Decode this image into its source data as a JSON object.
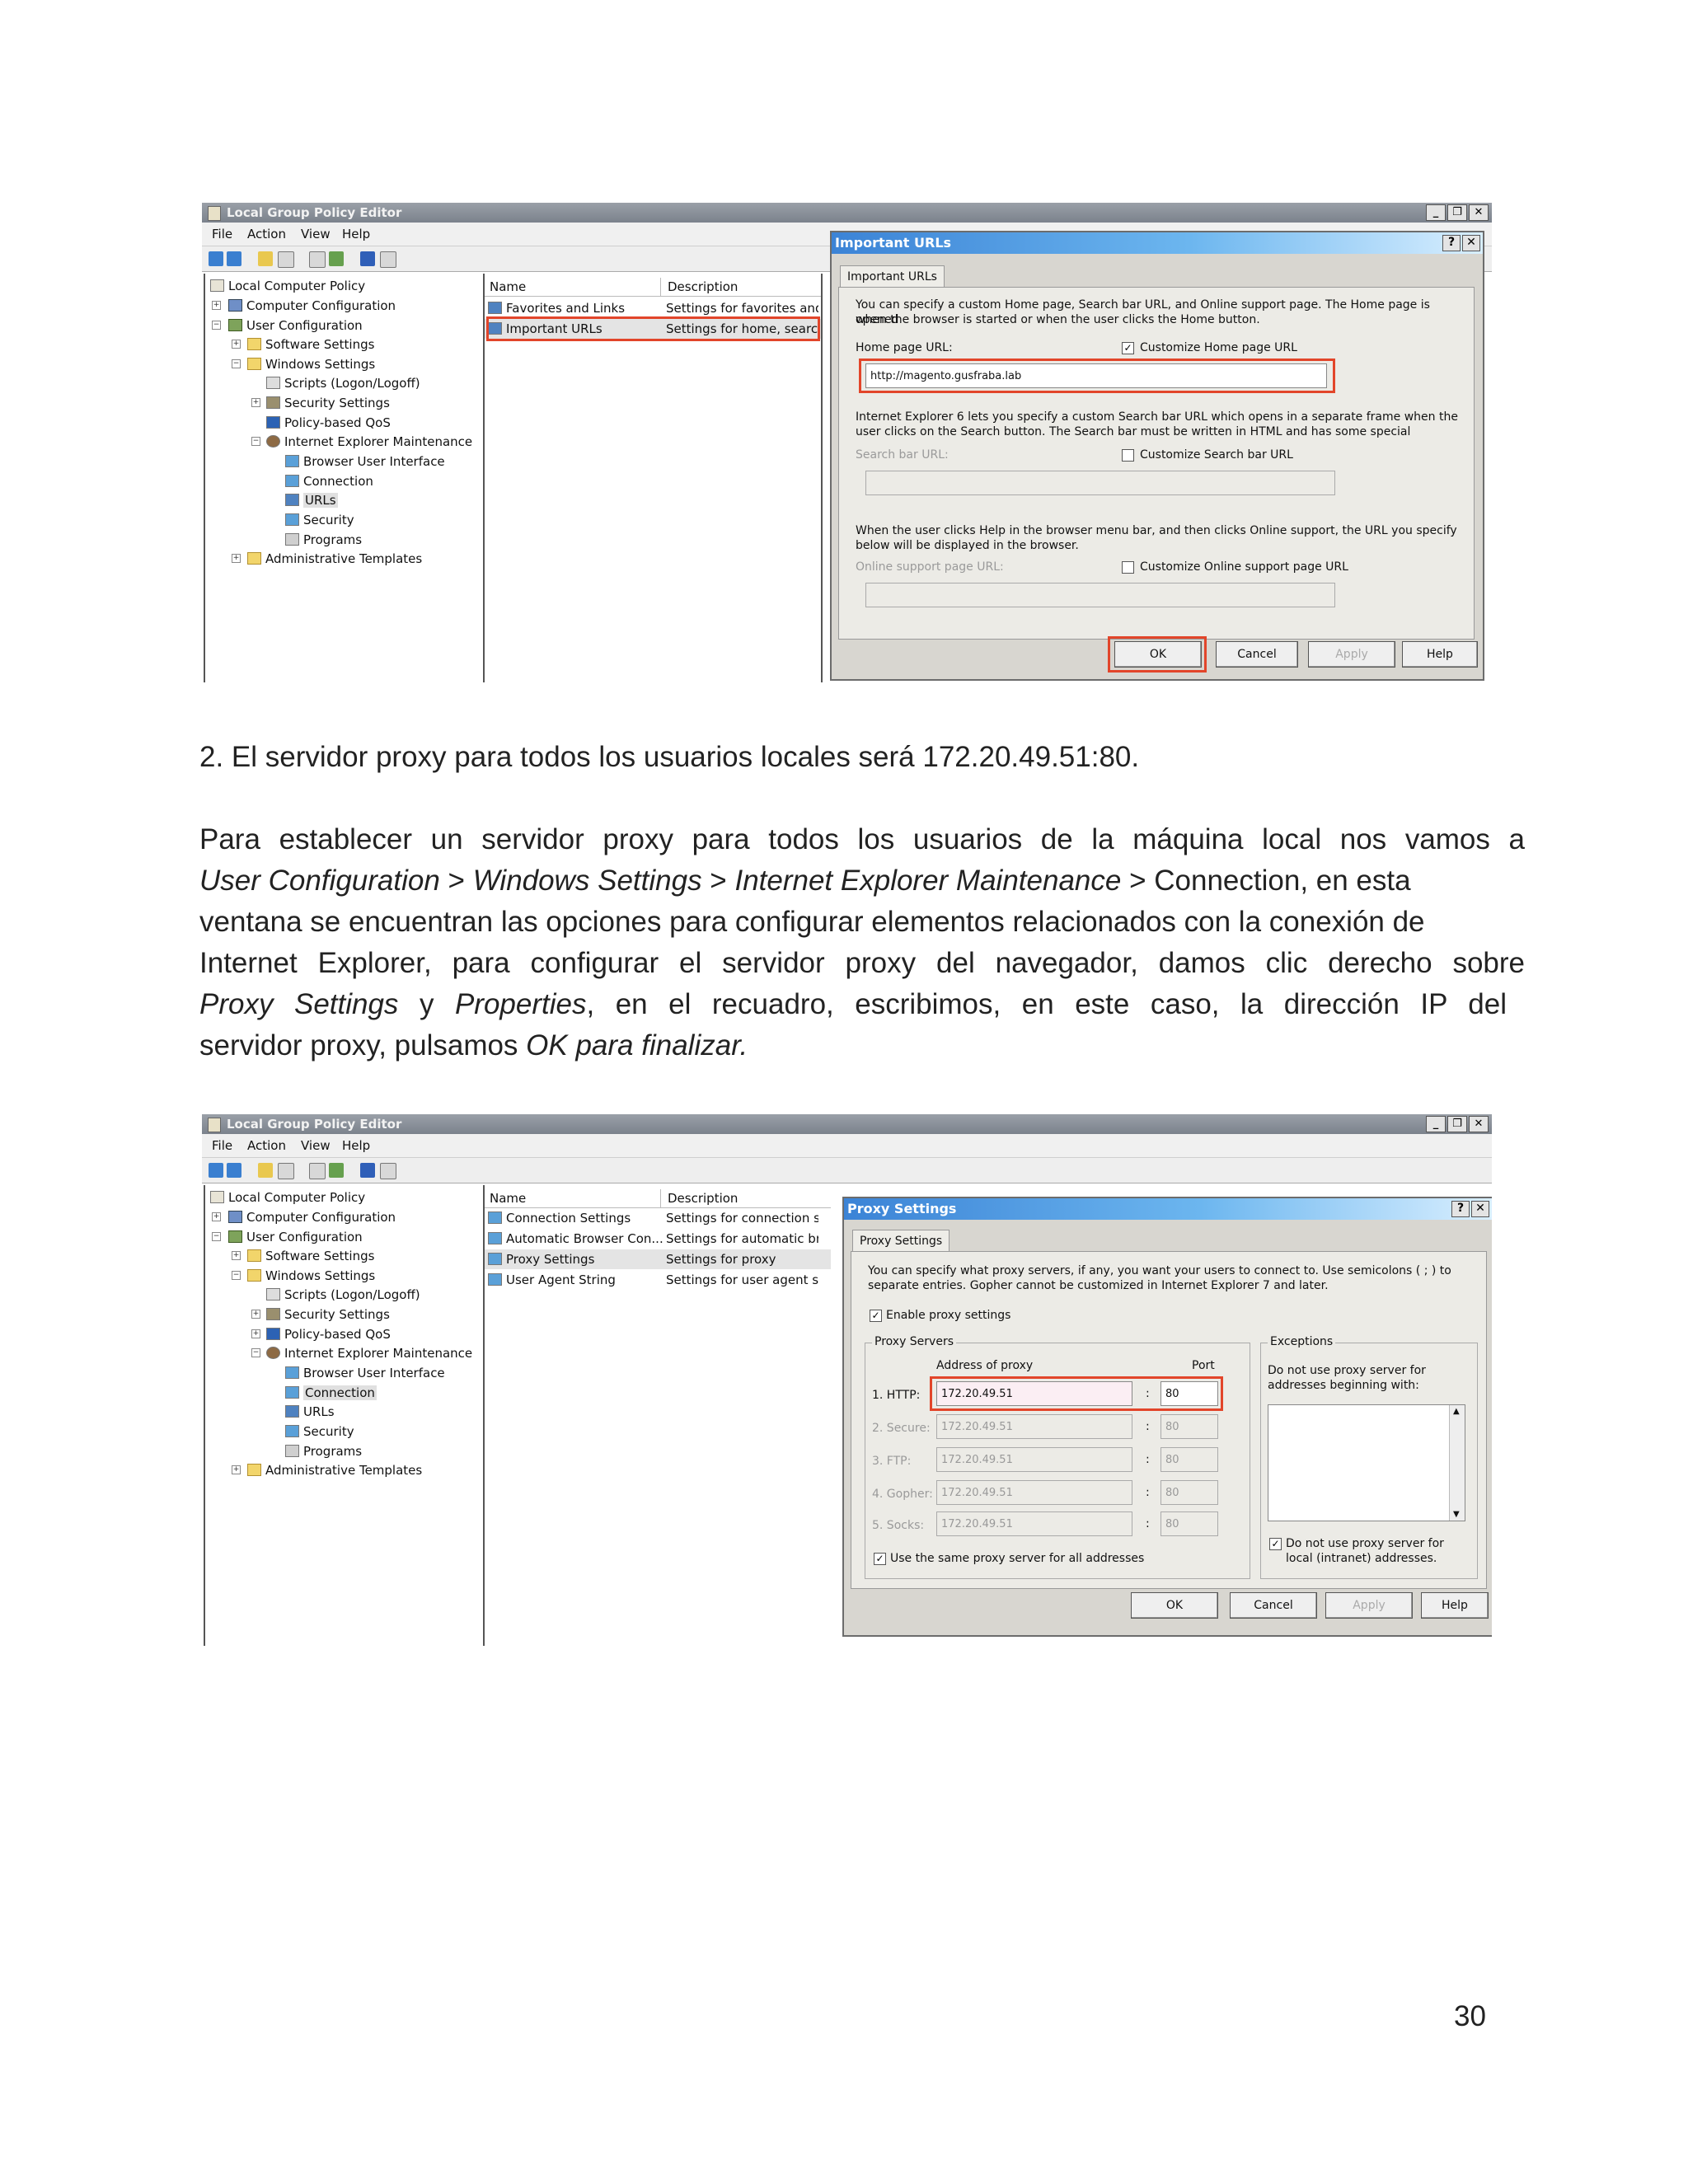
{
  "screenshot1": {
    "window_title": "Local Group Policy Editor",
    "menu": [
      "File",
      "Action",
      "View",
      "Help"
    ],
    "tree": [
      {
        "label": "Local Computer Policy"
      },
      {
        "label": "Computer Configuration"
      },
      {
        "label": "User Configuration"
      },
      {
        "label": "Software Settings"
      },
      {
        "label": "Windows Settings"
      },
      {
        "label": "Scripts (Logon/Logoff)"
      },
      {
        "label": "Security Settings"
      },
      {
        "label": "Policy-based QoS"
      },
      {
        "label": "Internet Explorer Maintenance"
      },
      {
        "label": "Browser User Interface"
      },
      {
        "label": "Connection"
      },
      {
        "label": "URLs"
      },
      {
        "label": "Security"
      },
      {
        "label": "Programs"
      },
      {
        "label": "Administrative Templates"
      }
    ],
    "list_headers": {
      "name": "Name",
      "description": "Description"
    },
    "list_rows": [
      {
        "name": "Favorites and Links",
        "description": "Settings for favorites and..."
      },
      {
        "name": "Important URLs",
        "description": "Settings for home, searc..."
      }
    ],
    "dialog": {
      "title": "Important URLs",
      "tab": "Important URLs",
      "intro_line1": "You can specify a custom Home page, Search bar URL, and Online support page. The Home page is opened",
      "intro_line2": "when the browser is started or when the user clicks the Home button.",
      "home_label": "Home page URL:",
      "home_checkbox": "Customize Home page URL",
      "home_value": "http://magento.gusfraba.lab",
      "search_text1": "Internet Explorer 6 lets you specify a custom Search bar URL which opens in a separate frame when the",
      "search_text2": "user clicks on the Search button. The Search bar must be written in HTML and has some special",
      "search_label": "Search bar URL:",
      "search_checkbox": "Customize Search bar URL",
      "support_text1": "When the user clicks Help in the browser menu bar, and then clicks Online support, the URL you specify",
      "support_text2": "below will be displayed in the browser.",
      "support_label": "Online support page URL:",
      "support_checkbox": "Customize Online support page URL",
      "btn_ok": "OK",
      "btn_cancel": "Cancel",
      "btn_apply": "Apply",
      "btn_help": "Help"
    }
  },
  "step_heading": "2. El servidor proxy para todos los usuarios locales será 172.20.49.51:80.",
  "paragraph": {
    "l1": "Para establecer un servidor proxy para todos los usuarios de la máquina local nos vamos a",
    "l2_i1": "User Configuration",
    "l2_s1": " > ",
    "l2_i2": "Windows Settings",
    "l2_s2": " > ",
    "l2_i3": "Internet Explorer Maintenance",
    "l2_s3": " > Connection, en esta",
    "l3": "ventana se encuentran las opciones para configurar elementos relacionados con la conexión de",
    "l4": "Internet Explorer, para configurar el servidor proxy del navegador, damos clic derecho sobre",
    "l5_i1": "Proxy Settings",
    "l5_s1": " y ",
    "l5_i2": "Properties",
    "l5_s2": ", en el recuadro, escribimos, en este caso, la dirección IP del",
    "l6_s1": "servidor proxy, pulsamos ",
    "l6_i1": "OK para finalizar."
  },
  "screenshot2": {
    "window_title": "Local Group Policy Editor",
    "menu": [
      "File",
      "Action",
      "View",
      "Help"
    ],
    "list_headers": {
      "name": "Name",
      "description": "Description"
    },
    "list_rows": [
      {
        "name": "Connection Settings",
        "description": "Settings for connection settin"
      },
      {
        "name": "Automatic Browser Con...",
        "description": "Settings for automatic browsi"
      },
      {
        "name": "Proxy Settings",
        "description": "Settings for proxy"
      },
      {
        "name": "User Agent String",
        "description": "Settings for user agent string"
      }
    ],
    "dialog": {
      "title": "Proxy Settings",
      "tab": "Proxy Settings",
      "intro_line1": "You can specify what proxy servers, if any, you want your users to connect to. Use semicolons ( ; ) to",
      "intro_line2": "separate entries. Gopher cannot be customized in Internet Explorer 7 and later.",
      "enable_label": "Enable proxy settings",
      "group_servers": "Proxy Servers",
      "col_address": "Address of proxy",
      "col_port": "Port",
      "rows": [
        {
          "label": "1. HTTP:",
          "address": "172.20.49.51",
          "port": "80"
        },
        {
          "label": "2. Secure:",
          "address": "172.20.49.51",
          "port": "80"
        },
        {
          "label": "3. FTP:",
          "address": "172.20.49.51",
          "port": "80"
        },
        {
          "label": "4. Gopher:",
          "address": "172.20.49.51",
          "port": "80"
        },
        {
          "label": "5. Socks:",
          "address": "172.20.49.51",
          "port": "80"
        }
      ],
      "same_proxy_label": "Use the same proxy server for all addresses",
      "group_exceptions": "Exceptions",
      "exceptions_text1": "Do not use proxy server for",
      "exceptions_text2": "addresses beginning with:",
      "local_text1": "Do not use proxy server for",
      "local_text2": "local (intranet) addresses.",
      "btn_ok": "OK",
      "btn_cancel": "Cancel",
      "btn_apply": "Apply",
      "btn_help": "Help"
    }
  },
  "page_number": "30",
  "colors": {
    "highlight": "#e2452a",
    "dialog_title": "#3b83d6"
  }
}
